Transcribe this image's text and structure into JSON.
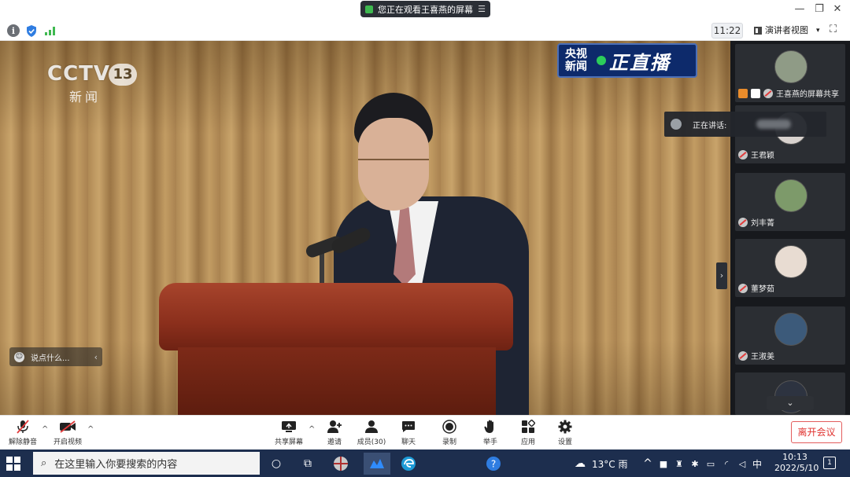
{
  "titlebar": {
    "share_notice": "您正在观看王喜燕的屏幕",
    "menu_glyph": "☰",
    "minimize": "—",
    "restore": "❐",
    "close": "✕"
  },
  "infobar": {
    "time": "11:22",
    "view_mode": "演讲者视图",
    "view_caret": "▾",
    "fullscreen_glyph": "⛶"
  },
  "stage": {
    "channel_logo": "CCTV",
    "channel_number": "13",
    "channel_sub": "新闻",
    "live_left": "央视\n新闻",
    "live_right": "正直播",
    "comment_placeholder": "说点什么...",
    "comment_chevron": "‹",
    "panel_toggle": "›"
  },
  "speaking": {
    "label": "正在讲话:"
  },
  "participants": [
    {
      "name": "王喜燕的屏幕共享",
      "avatar_color": "#8f9b86",
      "sharing": true
    },
    {
      "name": "王君颖",
      "avatar_color": "#d8d2ce",
      "sharing": false
    },
    {
      "name": "刘丰菁",
      "avatar_color": "#7d9a6a",
      "sharing": false
    },
    {
      "name": "董梦茹",
      "avatar_color": "#e8dcd2",
      "sharing": false
    },
    {
      "name": "王淑美",
      "avatar_color": "#3c5a7a",
      "sharing": false
    }
  ],
  "scroll_down": "⌄",
  "toolbar": {
    "unmute": "解除静音",
    "start_video": "开启视频",
    "share_screen": "共享屏幕",
    "invite": "邀请",
    "members": "成员(30)",
    "chat": "聊天",
    "record": "录制",
    "raise_hand": "举手",
    "apps": "应用",
    "settings": "设置",
    "leave": "离开会议",
    "caret": "^"
  },
  "taskbar": {
    "search_placeholder": "在这里输入你要搜索的内容",
    "weather": "13°C 雨",
    "ime": "中",
    "time": "10:13",
    "date": "2022/5/10",
    "notification_count": "1"
  },
  "colors": {
    "leave_red": "#e0322f",
    "panel_bg": "#17191d",
    "taskbar_bg": "#1d2e4e"
  }
}
